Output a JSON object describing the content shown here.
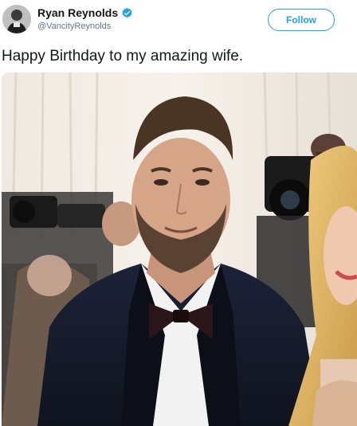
{
  "tweet": {
    "display_name": "Ryan Reynolds",
    "handle": "@VancityReynolds",
    "follow_label": "Follow",
    "text": "Happy Birthday to my amazing wife."
  },
  "icons": {
    "verified": "verified-badge-icon",
    "avatar": "profile-avatar"
  },
  "colors": {
    "accent": "#1da1f2",
    "text": "#14171a",
    "secondary_text": "#657786"
  }
}
